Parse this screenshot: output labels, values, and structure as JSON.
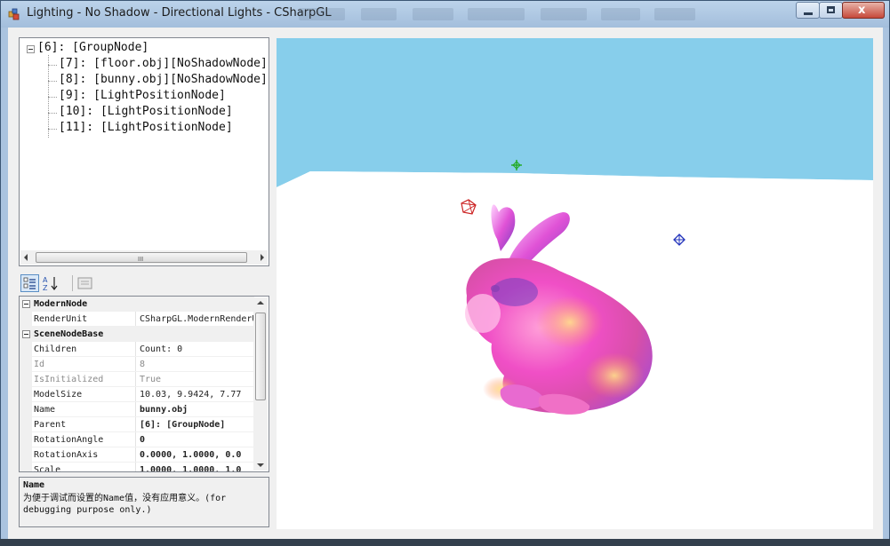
{
  "window": {
    "title": "Lighting - No Shadow - Directional Lights - CSharpGL",
    "controls": {
      "minimize": "minimize",
      "maximize": "maximize",
      "close": "x"
    }
  },
  "tree": {
    "root": "[6]: [GroupNode]",
    "children": [
      "[7]: [floor.obj][NoShadowNode]",
      "[8]: [bunny.obj][NoShadowNode]",
      "[9]: [LightPositionNode]",
      "[10]: [LightPositionNode]",
      "[11]: [LightPositionNode]"
    ]
  },
  "property_grid": {
    "toolbar": {
      "categorized_icon": "categorized-icon",
      "alphabetical_icon": "sort-alphabetical-icon",
      "pages_icon": "property-pages-icon"
    },
    "rows": [
      {
        "type": "category",
        "label": "ModernNode"
      },
      {
        "type": "prop",
        "name": "RenderUnit",
        "value": "CSharpGL.ModernRenderUnit",
        "state": "normal"
      },
      {
        "type": "category",
        "label": "SceneNodeBase"
      },
      {
        "type": "prop",
        "name": "Children",
        "value": "Count: 0",
        "state": "normal"
      },
      {
        "type": "prop",
        "name": "Id",
        "value": "8",
        "state": "readonly"
      },
      {
        "type": "prop",
        "name": "IsInitialized",
        "value": "True",
        "state": "readonly"
      },
      {
        "type": "prop",
        "name": "ModelSize",
        "value": "10.03, 9.9424, 7.77",
        "state": "normal"
      },
      {
        "type": "prop",
        "name": "Name",
        "value": "bunny.obj",
        "state": "bold"
      },
      {
        "type": "prop",
        "name": "Parent",
        "value": "[6]: [GroupNode]",
        "state": "bold"
      },
      {
        "type": "prop",
        "name": "RotationAngle",
        "value": "0",
        "state": "bold"
      },
      {
        "type": "prop",
        "name": "RotationAxis",
        "value": "0.0000, 1.0000, 0.0",
        "state": "bold"
      },
      {
        "type": "prop",
        "name": "Scale",
        "value": "1.0000, 1.0000, 1.0",
        "state": "bold"
      }
    ]
  },
  "help": {
    "title": "Name",
    "description": "为便于调试而设置的Name值，没有应用意义。(for debugging purpose only.)"
  },
  "viewport": {
    "sky_color": "#87ceeb",
    "floor_color": "#ffffff",
    "light_colors": [
      "#22aa22",
      "#cc2222",
      "#2233bb"
    ],
    "model": "bunny"
  }
}
